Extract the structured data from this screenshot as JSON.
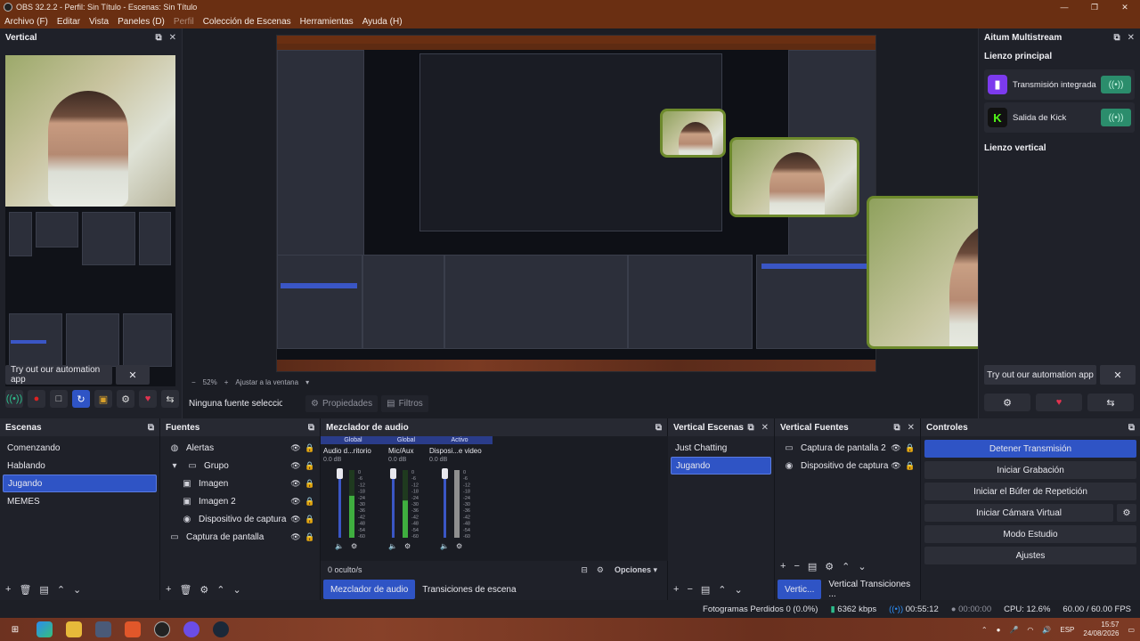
{
  "window": {
    "title": "OBS 32.2.2 - Perfil: Sin Título - Escenas: Sin Título"
  },
  "menu": [
    {
      "label": "Archivo (F)",
      "enabled": true
    },
    {
      "label": "Editar",
      "enabled": true
    },
    {
      "label": "Vista",
      "enabled": true
    },
    {
      "label": "Paneles (D)",
      "enabled": true
    },
    {
      "label": "Perfil",
      "enabled": false
    },
    {
      "label": "Colección de Escenas",
      "enabled": true
    },
    {
      "label": "Herramientas",
      "enabled": true
    },
    {
      "label": "Ayuda (H)",
      "enabled": true
    }
  ],
  "vertical_dock": {
    "title": "Vertical",
    "try_label": "Try out our automation app",
    "close_label": "✕"
  },
  "preview": {
    "zoom": "52%",
    "fit_label": "Ajustar a la ventana",
    "no_source": "Ninguna fuente seleccionada",
    "properties_label": "Propiedades",
    "filters_label": "Filtros"
  },
  "multistream": {
    "title": "Aitum Multistream",
    "main_canvas": "Lienzo principal",
    "outputs": [
      {
        "label": "Transmisión integrada",
        "logo": "twitch-icon",
        "color": "#7c3aed",
        "state": "on"
      },
      {
        "label": "Salida de Kick",
        "logo": "kick-icon",
        "color": "#111111",
        "state": "on"
      }
    ],
    "vertical_canvas": "Lienzo vertical",
    "try_label": "Try out our automation app"
  },
  "scenes": {
    "title": "Escenas",
    "items": [
      "Comenzando",
      "Hablando",
      "Jugando",
      "MEMES"
    ],
    "selected": 2
  },
  "sources": {
    "title": "Fuentes",
    "items": [
      {
        "name": "Alertas",
        "icon": "globe-icon",
        "indent": 0
      },
      {
        "name": "Grupo",
        "icon": "folder-icon",
        "indent": 0,
        "expanded": true
      },
      {
        "name": "Imagen",
        "icon": "image-icon",
        "indent": 1
      },
      {
        "name": "Imagen 2",
        "icon": "image-icon",
        "indent": 1
      },
      {
        "name": "Dispositivo de captura de v",
        "icon": "camera-icon",
        "indent": 1
      },
      {
        "name": "Captura de pantalla",
        "icon": "monitor-icon",
        "indent": 0
      }
    ]
  },
  "mixer": {
    "title": "Mezclador de audio",
    "channels": [
      {
        "head": "Global",
        "name": "Audio d...ritorio",
        "db": "0.0 dB",
        "level": 0.62
      },
      {
        "head": "Global",
        "name": "Mic/Aux",
        "db": "0.0 dB",
        "level": 0.55
      },
      {
        "head": "Activo",
        "name": "Disposi...e video",
        "db": "0.0 dB",
        "level": 0.0
      }
    ],
    "scale": [
      "0",
      "-6",
      "-12",
      "-18",
      "-24",
      "-30",
      "-36",
      "-42",
      "-48",
      "-54",
      "-60"
    ],
    "hidden": "0 oculto/s",
    "options": "Opciones",
    "tabs": [
      "Mezclador de audio",
      "Transiciones de escena"
    ]
  },
  "vertical_scenes": {
    "title": "Vertical Escenas",
    "items": [
      "Just Chatting",
      "Jugando"
    ],
    "selected": 1
  },
  "vertical_sources": {
    "title": "Vertical Fuentes",
    "items": [
      {
        "name": "Captura de pantalla 2",
        "icon": "monitor-icon"
      },
      {
        "name": "Dispositivo de captura",
        "icon": "camera-icon"
      }
    ],
    "tabs": [
      "Vertic...",
      "Vertical Transiciones ..."
    ]
  },
  "controls": {
    "title": "Controles",
    "buttons": [
      "Detener Transmisión",
      "Iniciar Grabación",
      "Iniciar el Búfer de Repetición",
      "Iniciar Cámara Virtual",
      "Modo Estudio",
      "Ajustes"
    ]
  },
  "status": {
    "dropped": "Fotogramas Perdidos 0 (0.0%)",
    "bitrate": "6362 kbps",
    "stream_time": "00:55:12",
    "rec_time": "00:00:00",
    "cpu": "CPU: 12.6%",
    "fps": "60.00 / 60.00 FPS"
  },
  "taskbar": {
    "lang": "ESP",
    "time": "15:57",
    "date": "24/08/2026"
  }
}
